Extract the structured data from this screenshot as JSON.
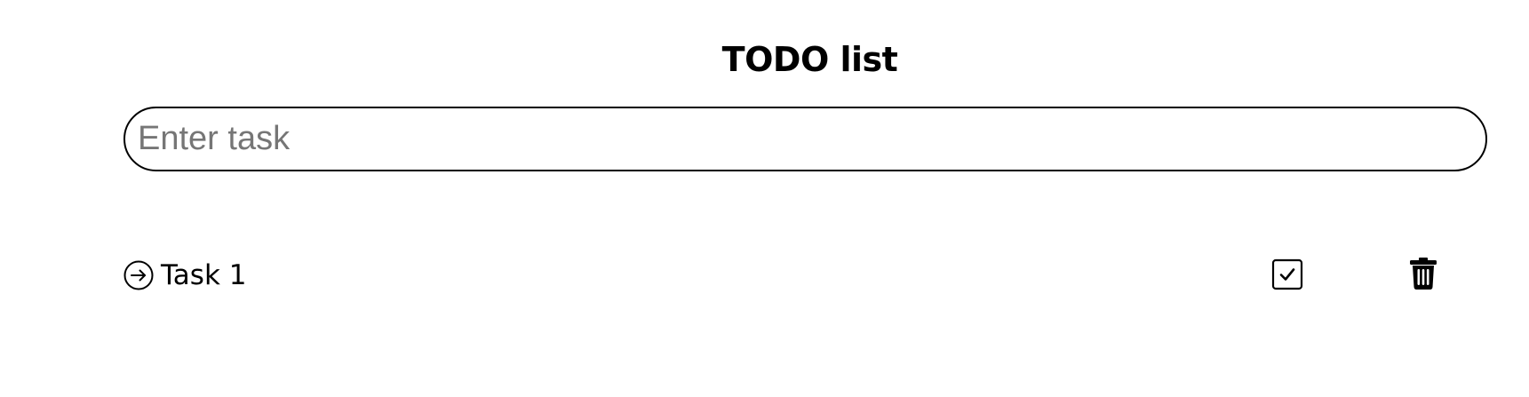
{
  "header": {
    "title": "TODO list"
  },
  "task_input": {
    "value": "",
    "placeholder": "Enter task"
  },
  "tasks": [
    {
      "label": "Task 1",
      "status_icon": "arrow-right-circle-icon",
      "complete_icon": "check-square-icon",
      "delete_icon": "trash-icon"
    }
  ]
}
